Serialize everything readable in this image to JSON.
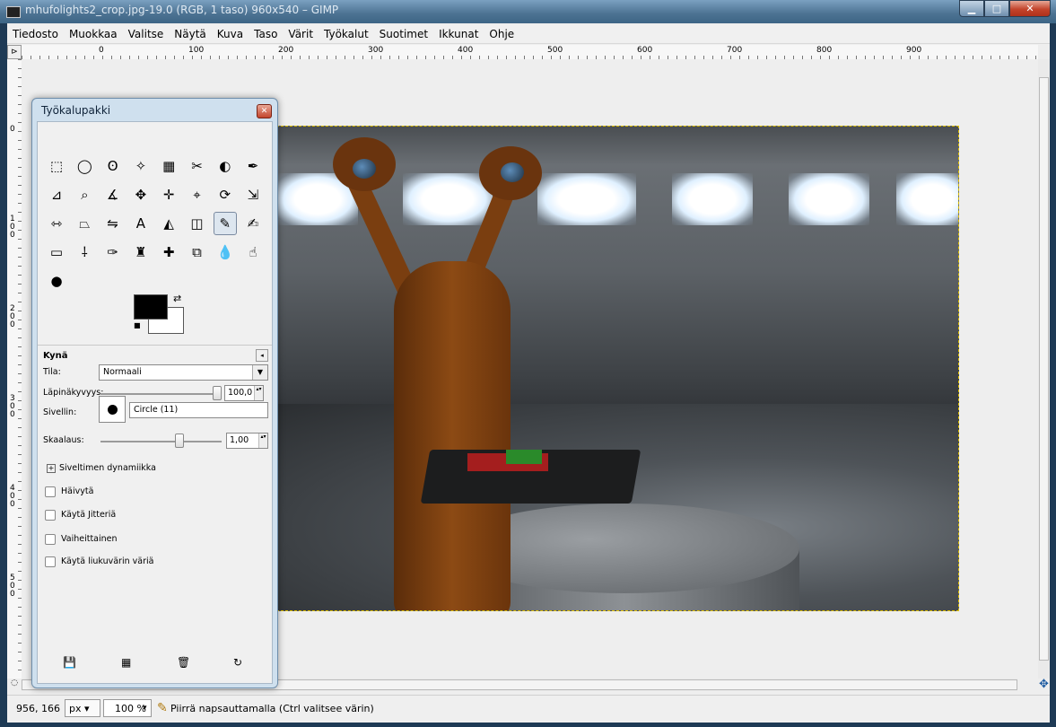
{
  "window": {
    "title": "mhufolights2_crop.jpg-19.0 (RGB, 1 taso) 960x540 – GIMP",
    "minimize": "▁",
    "maximize": "□",
    "close": "✕"
  },
  "menubar": {
    "items": [
      "Tiedosto",
      "Muokkaa",
      "Valitse",
      "Näytä",
      "Kuva",
      "Taso",
      "Värit",
      "Työkalut",
      "Suotimet",
      "Ikkunat",
      "Ohje"
    ]
  },
  "rulers": {
    "corner": "⊳",
    "horizontal_ticks": [
      "0",
      "100",
      "200",
      "300",
      "400",
      "500",
      "600",
      "700",
      "800",
      "900"
    ],
    "vertical_ticks": [
      "0",
      "100",
      "200",
      "300",
      "400",
      "500"
    ]
  },
  "statusbar": {
    "coords": "956, 166",
    "unit": "px",
    "unit_arrow": "▾",
    "zoom": "100 %",
    "zoom_arrow": "▾",
    "message": "Piirrä napsauttamalla (Ctrl valitsee värin)"
  },
  "toolbox": {
    "title": "Työkalupakki",
    "tools": [
      "rect-select",
      "ellipse-select",
      "free-select",
      "fuzzy-select",
      "select-by-color",
      "scissors",
      "foreground-select",
      "paths",
      "color-picker",
      "zoom",
      "measure",
      "move",
      "align",
      "crop",
      "rotate",
      "scale",
      "shear",
      "perspective",
      "flip",
      "text",
      "bucket-fill",
      "blend",
      "pencil",
      "paintbrush",
      "eraser",
      "airbrush",
      "ink",
      "clone",
      "heal",
      "perspective-clone",
      "blur",
      "smudge",
      "dodge-burn"
    ],
    "tool_glyphs": [
      "⬚",
      "◯",
      "ʘ",
      "✧",
      "▦",
      "✂",
      "◐",
      "✒",
      "⊿",
      "⌕",
      "∡",
      "✥",
      "✛",
      "⌖",
      "⟳",
      "⇲",
      "⇿",
      "⏢",
      "⇋",
      "A",
      "◭",
      "◫",
      "✎",
      "✍",
      "▭",
      "⸸",
      "✑",
      "♜",
      "✚",
      "⧉",
      "💧",
      "☝",
      "●"
    ],
    "fg_color": "#000000",
    "bg_color": "#ffffff",
    "swap": "⇄",
    "reset": "■"
  },
  "tool_options": {
    "title": "Kynä",
    "menu_glyph": "◂",
    "mode_label": "Tila:",
    "mode_value": "Normaali",
    "mode_arrow": "▼",
    "opacity_label": "Läpinäkyvyys:",
    "opacity_value": "100,0",
    "opacity_level": 1.0,
    "brush_label": "Sivellin:",
    "brush_value": "Circle (11)",
    "scale_label": "Skaalaus:",
    "scale_value": "1,00",
    "spin_arrows": "▴▾",
    "dynamics_label": "Siveltimen dynamiikka",
    "dynamics_plus": "+",
    "checkboxes": [
      "Häivytä",
      "Käytä Jitteriä",
      "Vaiheittainen",
      "Käytä liukuvärin väriä"
    ]
  },
  "bottom_icons": [
    "💾",
    "▦",
    "🗑",
    "↻"
  ],
  "nav_icon": "✥",
  "quickmask_icon": "◌"
}
